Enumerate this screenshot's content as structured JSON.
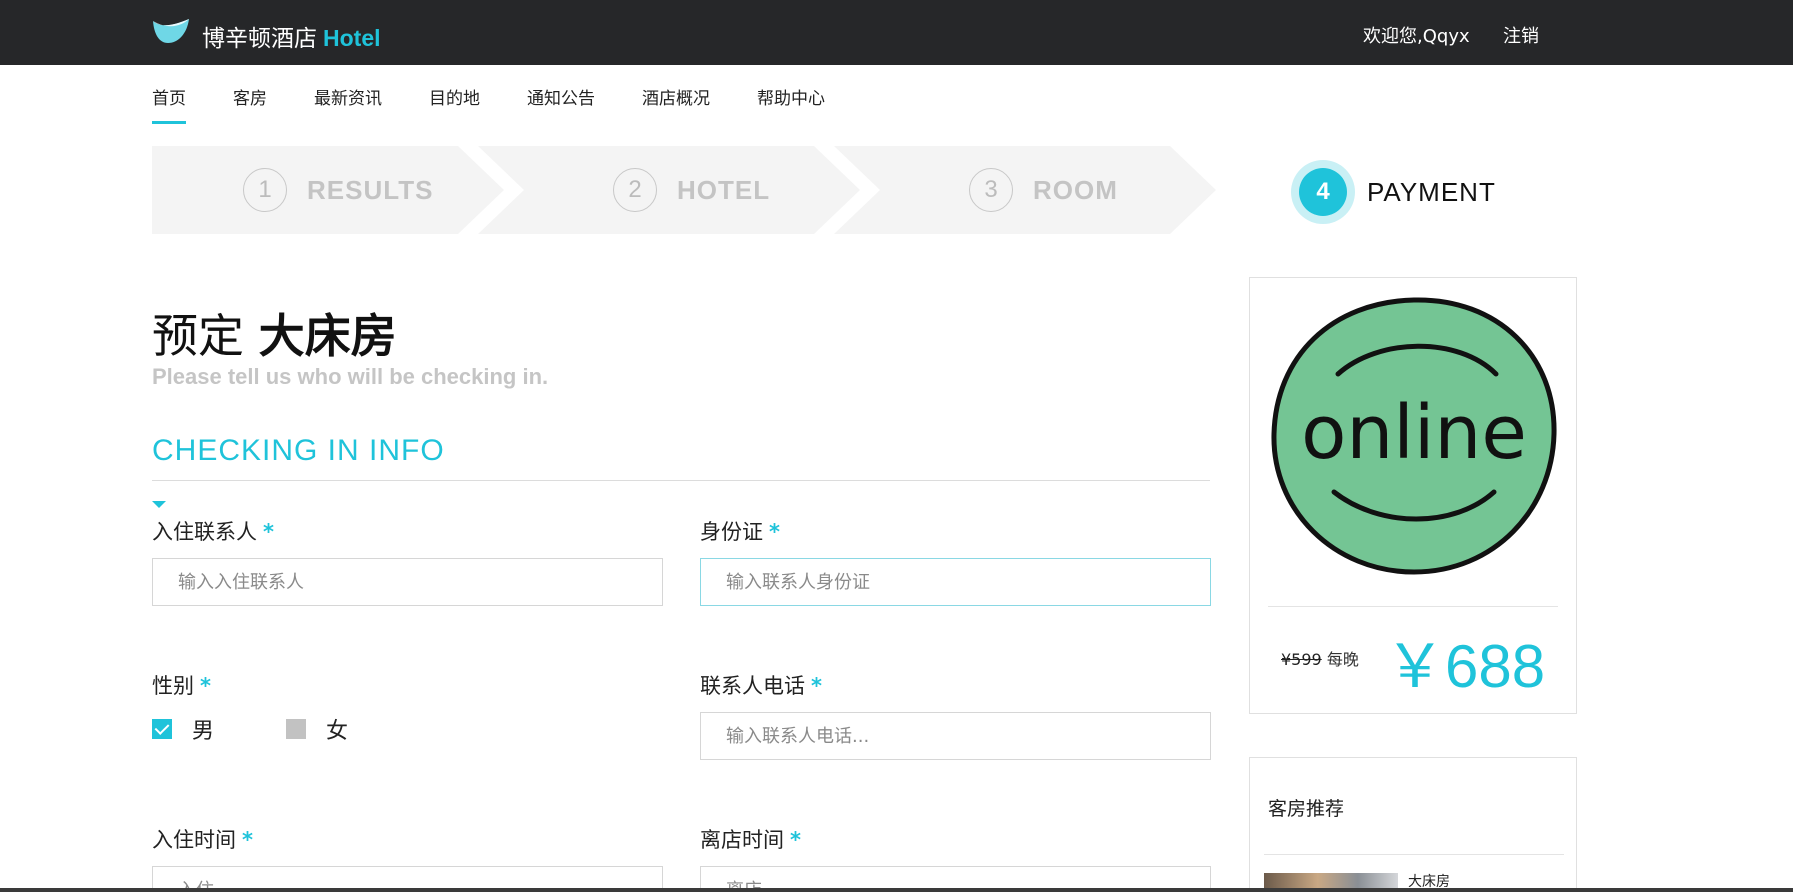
{
  "header": {
    "brand_cn": "博辛顿酒店",
    "brand_en": "Hotel",
    "welcome": "欢迎您,Qqyx",
    "logout": "注销"
  },
  "nav": {
    "items": [
      "首页",
      "客房",
      "最新资讯",
      "目的地",
      "通知公告",
      "酒店概况",
      "帮助中心"
    ],
    "active": "首页"
  },
  "steps": [
    {
      "num": "1",
      "label": "RESULTS"
    },
    {
      "num": "2",
      "label": "HOTEL"
    },
    {
      "num": "3",
      "label": "ROOM"
    },
    {
      "num": "4",
      "label": "PAYMENT",
      "active": true
    }
  ],
  "booking": {
    "title_prefix": "预定",
    "room_name": "大床房",
    "subtitle": "Please tell us who will be checking in.",
    "section": "CHECKING IN INFO"
  },
  "form": {
    "contact": {
      "label": "入住联系人",
      "required": "*",
      "placeholder": "输入入住联系人"
    },
    "id_card": {
      "label": "身份证",
      "required": "*",
      "placeholder": "输入联系人身份证"
    },
    "gender": {
      "label": "性别",
      "required": "*",
      "options": [
        "男",
        "女"
      ],
      "selected": "男"
    },
    "phone": {
      "label": "联系人电话",
      "required": "*",
      "placeholder": "输入联系人电话..."
    },
    "checkin": {
      "label": "入住时间",
      "required": "*",
      "placeholder": "入住"
    },
    "checkout": {
      "label": "离店时间",
      "required": "*",
      "placeholder": "离店"
    }
  },
  "price_card": {
    "image_text": "online",
    "old_price": "¥599",
    "per_night": "每晚",
    "price": "￥688"
  },
  "recommend": {
    "title": "客房推荐",
    "items": [
      {
        "name": "大床房"
      }
    ]
  },
  "colors": {
    "accent": "#1fc3da",
    "topbar": "#262729",
    "badge_green": "#74c594"
  }
}
